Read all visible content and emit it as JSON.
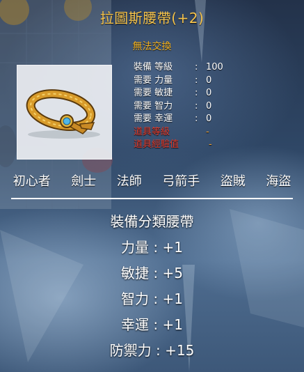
{
  "item": {
    "title": "拉圖斯腰帶(+2)",
    "untradeable": "無法交換"
  },
  "requirements": [
    {
      "label": "裝備 等級",
      "sep": ":",
      "value": "100",
      "style": "normal"
    },
    {
      "label": "需要 力量",
      "sep": ":",
      "value": "0",
      "style": "normal"
    },
    {
      "label": "需要 敏捷",
      "sep": ":",
      "value": "0",
      "style": "normal"
    },
    {
      "label": "需要 智力",
      "sep": ":",
      "value": "0",
      "style": "normal"
    },
    {
      "label": "需要 幸運",
      "sep": ":",
      "value": "0",
      "style": "normal"
    },
    {
      "label": "道具等級",
      "sep": "",
      "value": "-",
      "style": "red"
    },
    {
      "label": "道具經驗值",
      "sep": "",
      "value": "-",
      "style": "red"
    }
  ],
  "jobs": [
    "初心者",
    "劍士",
    "法師",
    "弓箭手",
    "盜賊",
    "海盜"
  ],
  "stats": [
    "裝備分類腰帶",
    "力量 : +1",
    "敏捷 : +5",
    "智力 : +1",
    "幸運 : +1",
    "防禦力 : +15"
  ]
}
